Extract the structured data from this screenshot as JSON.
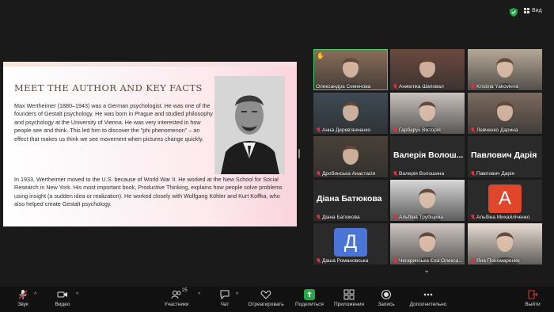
{
  "top": {
    "view_label": "Вид"
  },
  "slide": {
    "title": "MEET THE AUTHOR AND KEY FACTS",
    "p1": "Max Wertheimer (1880–1943) was a German psychologist. He was one of the founders of Gestalt psychology. He was born in Prague and studied philosophy and psychology at the University of Vienna. He was very interested in how people see and think. This led him to discover the \"phi phenomenon\" – an effect that makes us think we see movement when pictures change quickly.",
    "p2": "In 1933, Wertheimer moved to the U.S. because of World War II. He worked at the New School for Social Research in New York. His most important book, Productive Thinking, explains how people solve problems using insight (a sudden idea or realization). He worked closely with Wolfgang Köhler and Kurt Koffka, who also helped create Gestalt psychology."
  },
  "participants": [
    {
      "name": "Олександра Семенова",
      "muted": false,
      "active": true,
      "raised_hand": true,
      "video": true,
      "bg": "#8a6e5a"
    },
    {
      "name": "Анжеліка Шаповал",
      "muted": true,
      "video": true,
      "bg": "#6b4a3f"
    },
    {
      "name": "Kristina Yakovleva",
      "muted": true,
      "video": true,
      "bg": "#b7a999"
    },
    {
      "name": "Анна Дерев'янченко",
      "muted": true,
      "video": true,
      "bg": "#3e4a55"
    },
    {
      "name": "Гарбарук Вікторія",
      "muted": true,
      "video": true,
      "bg": "#c9c2bd"
    },
    {
      "name": "Левченко Дарина",
      "muted": true,
      "video": true,
      "bg": "#7b6a5e"
    },
    {
      "name": "Дробинська Анастасія",
      "muted": true,
      "video": true,
      "bg": "#4a4138"
    },
    {
      "name": "Валерія Волошина",
      "big_name": "Валерія Волош...",
      "muted": true,
      "video": false
    },
    {
      "name": "Павлович Дарія",
      "big_name": "Павлович Дарія",
      "muted": true,
      "video": false
    },
    {
      "name": "Діана Батюкова",
      "big_name": "Діана Батюкова",
      "muted": true,
      "video": false
    },
    {
      "name": "Альбіна Трубіцина",
      "muted": true,
      "video": false,
      "photo": true,
      "bg": "#d8d8d8"
    },
    {
      "name": "Альбіна Михайліченко",
      "muted": true,
      "video": false,
      "letter": "А",
      "letter_bg": "#e0462c"
    },
    {
      "name": "Даша Романовська",
      "muted": true,
      "video": false,
      "letter": "Д",
      "letter_bg": "#4a74d6"
    },
    {
      "name": "Чегаринська Єва Олекса...",
      "muted": true,
      "video": false,
      "photo": true,
      "bg": "#cfc7c3"
    },
    {
      "name": "Яна Пономаренко",
      "muted": true,
      "video": false,
      "photo": true,
      "bg": "#e8ddd3"
    }
  ],
  "toolbar": {
    "audio": "Звук",
    "video": "Видео",
    "participants": "Участники",
    "participants_count": "25",
    "chat": "Чат",
    "react": "Отреагировать",
    "share": "Поделиться",
    "apps": "Приложения",
    "record": "Запись",
    "more": "Дополнительно",
    "leave": "Выйти"
  },
  "colors": {
    "active_speaker": "#3ecf6a",
    "muted": "#e0323c",
    "share": "#23a847",
    "leave": "#e0323c"
  }
}
